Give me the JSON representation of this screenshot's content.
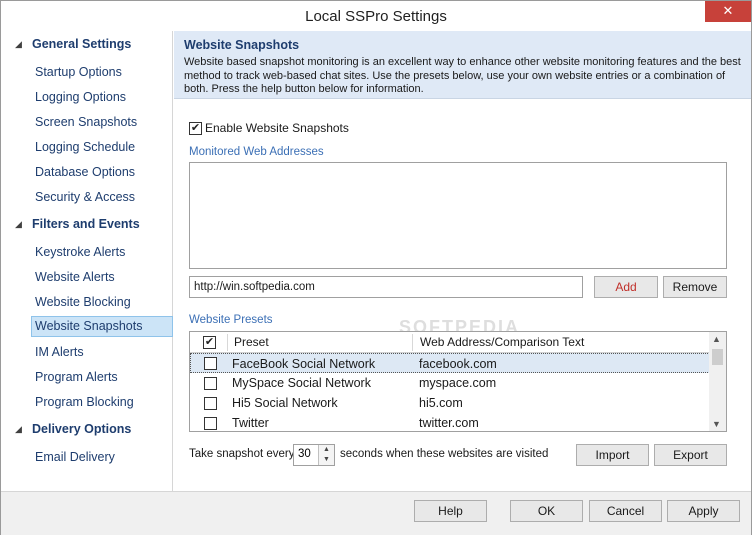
{
  "window": {
    "title": "Local SSPro Settings",
    "close_glyph": "✕"
  },
  "sidebar": {
    "groups": [
      {
        "label": "General Settings",
        "items": [
          "Startup Options",
          "Logging Options",
          "Screen Snapshots",
          "Logging Schedule",
          "Database Options",
          "Security & Access"
        ]
      },
      {
        "label": "Filters and Events",
        "items": [
          "Keystroke Alerts",
          "Website Alerts",
          "Website Blocking",
          "Website Snapshots",
          "IM Alerts",
          "Program Alerts",
          "Program Blocking"
        ]
      },
      {
        "label": "Delivery Options",
        "items": [
          "Email Delivery"
        ]
      }
    ],
    "selected": "Website Snapshots"
  },
  "header": {
    "title": "Website Snapshots",
    "description": "Website based snapshot monitoring is an excellent way to enhance other website monitoring features and the best method to track web-based chat sites. Use the presets below, use your own website entries or a combination of both. Press the help button below for information."
  },
  "enable": {
    "label": "Enable Website Snapshots",
    "checked": true
  },
  "monitored": {
    "label": "Monitored Web Addresses",
    "entries": []
  },
  "url_input": {
    "value": "http://win.softpedia.com"
  },
  "buttons": {
    "add": "Add",
    "remove": "Remove",
    "import": "Import",
    "export": "Export",
    "help": "Help",
    "ok": "OK",
    "cancel": "Cancel",
    "apply": "Apply"
  },
  "presets": {
    "label": "Website Presets",
    "columns": [
      "Preset",
      "Web Address/Comparison Text"
    ],
    "header_checked": true,
    "rows": [
      {
        "preset": "FaceBook Social Network",
        "address": "facebook.com",
        "checked": false
      },
      {
        "preset": "MySpace Social Network",
        "address": "myspace.com",
        "checked": false
      },
      {
        "preset": "Hi5 Social Network",
        "address": "hi5.com",
        "checked": false
      },
      {
        "preset": "Twitter",
        "address": "twitter.com",
        "checked": false
      }
    ]
  },
  "snapshot": {
    "prefix": "Take snapshot every",
    "value": "30",
    "suffix": "seconds when these websites are visited"
  },
  "watermark": "SOFTPEDIA",
  "colors": {
    "nav_text": "#1e3d6e",
    "section_label": "#3b6fb5",
    "header_bg": "#dfe9f6",
    "selected_bg": "#cce4f7",
    "close_bg": "#c7413a"
  }
}
